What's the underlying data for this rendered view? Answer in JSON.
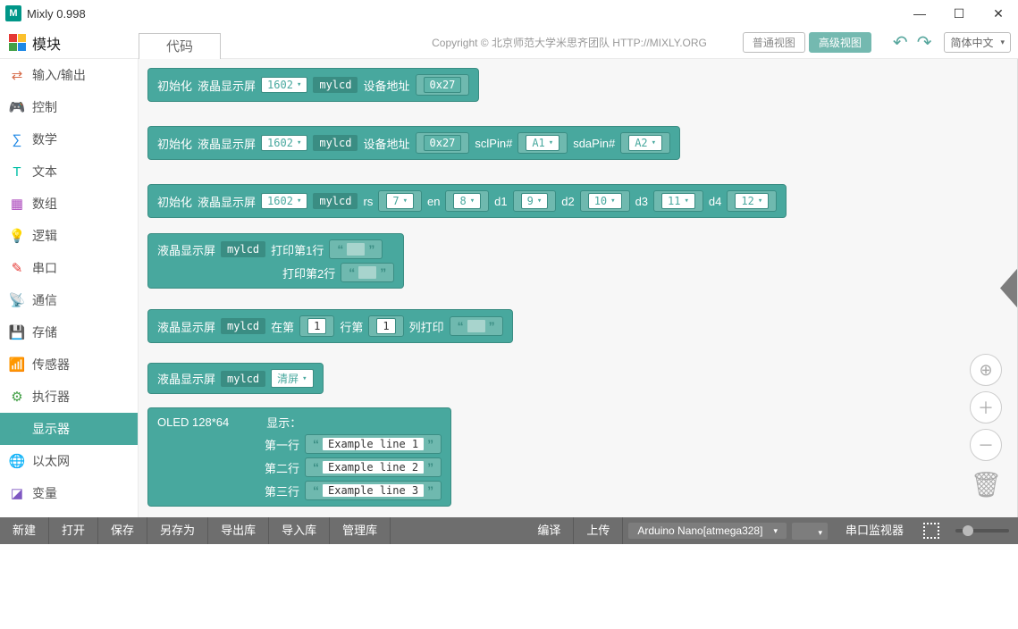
{
  "window": {
    "title": "Mixly 0.998"
  },
  "topbar": {
    "modules": "模块",
    "tab_code": "代码",
    "copyright": "Copyright  ©  北京师范大学米思齐团队  HTTP://MIXLY.ORG",
    "view_normal": "普通视图",
    "view_advanced": "高级视图",
    "language": "简体中文"
  },
  "sidebar": [
    {
      "id": "io",
      "label": "输入/输出",
      "color": "#d66c4a",
      "glyph": "⇄"
    },
    {
      "id": "ctrl",
      "label": "控制",
      "color": "#8bc34a",
      "glyph": "🎮"
    },
    {
      "id": "math",
      "label": "数学",
      "color": "#1e88e5",
      "glyph": "∑"
    },
    {
      "id": "text",
      "label": "文本",
      "color": "#00bfa5",
      "glyph": "T"
    },
    {
      "id": "array",
      "label": "数组",
      "color": "#ab47bc",
      "glyph": "▦"
    },
    {
      "id": "logic",
      "label": "逻辑",
      "color": "#fbc02d",
      "glyph": "💡"
    },
    {
      "id": "serial",
      "label": "串口",
      "color": "#e53935",
      "glyph": "✎"
    },
    {
      "id": "comm",
      "label": "通信",
      "color": "#8bc34a",
      "glyph": "📡"
    },
    {
      "id": "store",
      "label": "存储",
      "color": "#ef5350",
      "glyph": "💾"
    },
    {
      "id": "sensor",
      "label": "传感器",
      "color": "#8d6e63",
      "glyph": "📶"
    },
    {
      "id": "actuator",
      "label": "执行器",
      "color": "#43a047",
      "glyph": "⚙"
    },
    {
      "id": "display",
      "label": "显示器",
      "color": "#48a89e",
      "glyph": "🖥"
    },
    {
      "id": "ethernet",
      "label": "以太网",
      "color": "#e53935",
      "glyph": "🌐"
    },
    {
      "id": "var",
      "label": "变量",
      "color": "#7e57c2",
      "glyph": "◪"
    }
  ],
  "blocks": {
    "b1": {
      "init": "初始化",
      "lcdname": "液晶显示屏",
      "type": "1602",
      "var": "mylcd",
      "addr_label": "设备地址",
      "addr": "0x27"
    },
    "b2": {
      "scl": "sclPin#",
      "scl_v": "A1",
      "sda": "sdaPin#",
      "sda_v": "A2"
    },
    "b3": {
      "rs": "rs",
      "rs_v": "7",
      "en": "en",
      "en_v": "8",
      "d1": "d1",
      "d1_v": "9",
      "d2": "d2",
      "d2_v": "10",
      "d3": "d3",
      "d3_v": "11",
      "d4": "d4",
      "d4_v": "12"
    },
    "b4": {
      "lcd": "液晶显示屏",
      "var": "mylcd",
      "print1": "打印第1行",
      "print2": "打印第2行"
    },
    "b5": {
      "lcd": "液晶显示屏",
      "var": "mylcd",
      "at": "在第",
      "row_v": "1",
      "row": "行第",
      "col_v": "1",
      "col_print": "列打印"
    },
    "b6": {
      "lcd": "液晶显示屏",
      "var": "mylcd",
      "clear": "清屏"
    },
    "b7": {
      "oled": "OLED 128*64",
      "show": "显示：",
      "l1": "第一行",
      "l1v": "Example line 1",
      "l2": "第二行",
      "l2v": "Example line 2",
      "l3": "第三行",
      "l3v": "Example line 3"
    }
  },
  "footer": {
    "new": "新建",
    "open": "打开",
    "save": "保存",
    "saveas": "另存为",
    "export": "导出库",
    "import": "导入库",
    "manage": "管理库",
    "compile": "编译",
    "upload": "上传",
    "board": "Arduino Nano[atmega328]",
    "monitor": "串口监视器"
  }
}
